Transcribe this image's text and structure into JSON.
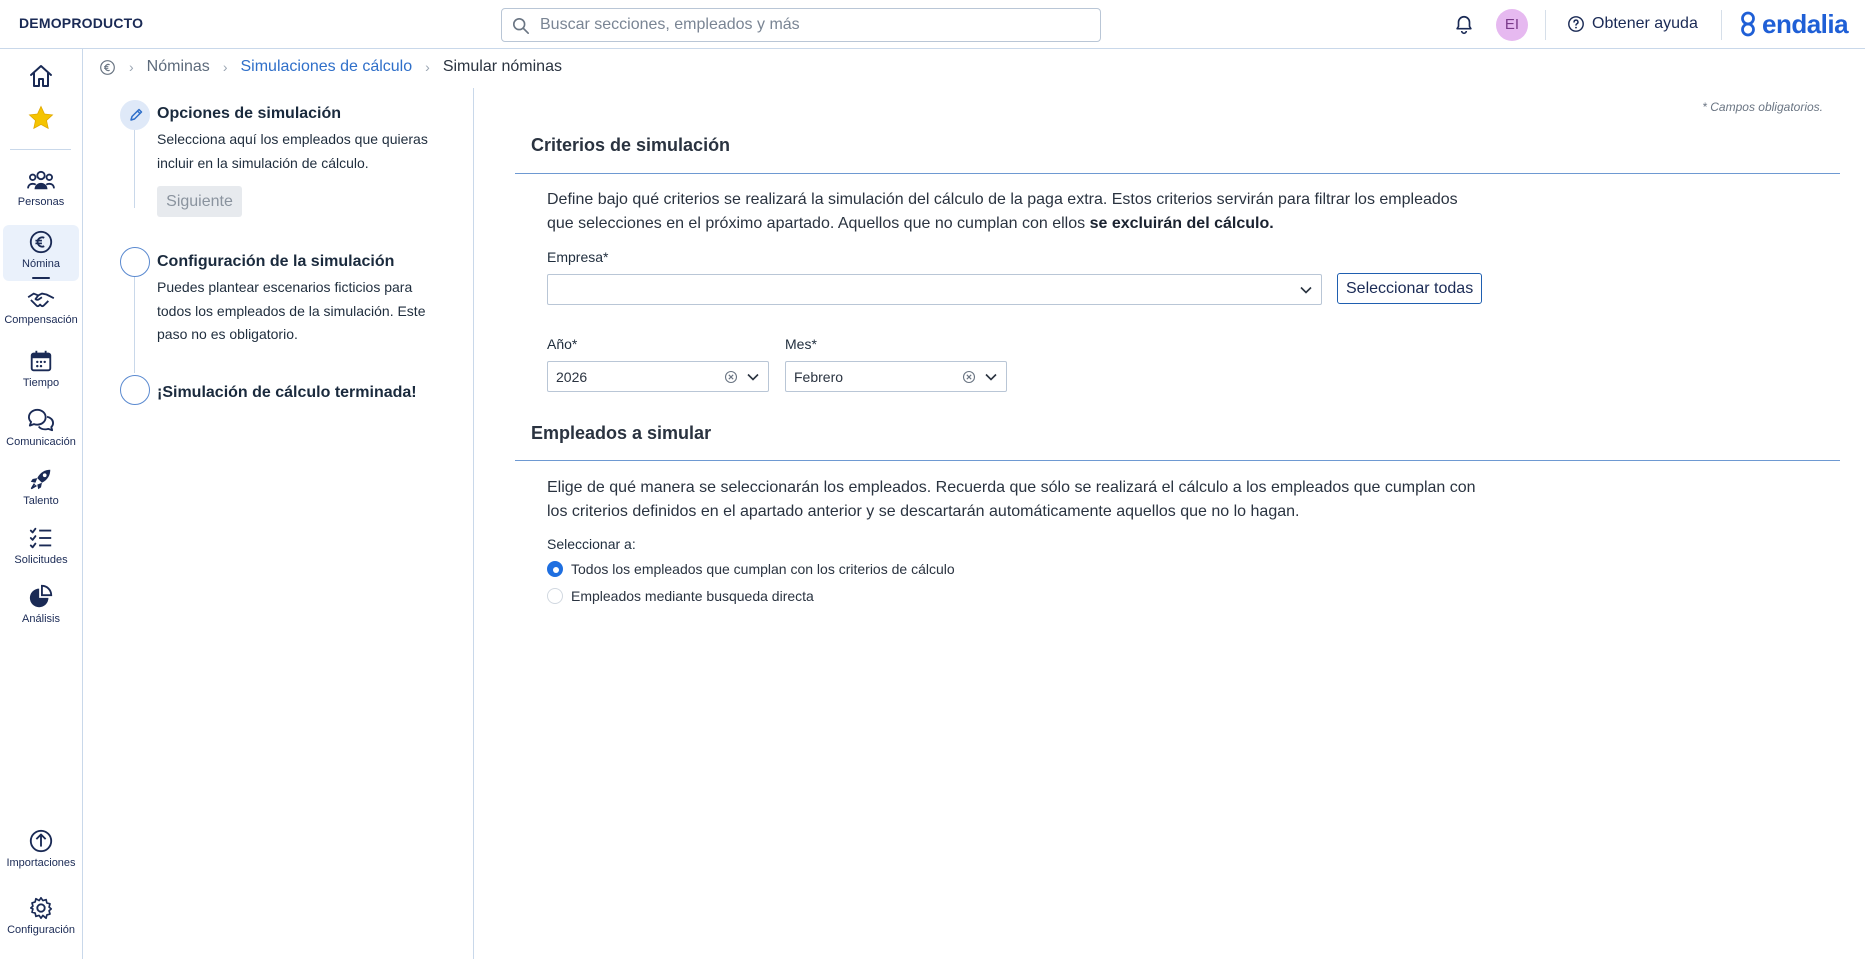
{
  "header": {
    "company": "DEMOPRODUCTO",
    "search_placeholder": "Buscar secciones, empleados y más",
    "avatar_initials": "EI",
    "help_label": "Obtener ayuda",
    "logo_text": "endalia"
  },
  "sidebar": {
    "items": [
      {
        "label": "Personas",
        "icon": "people-icon"
      },
      {
        "label": "Nómina",
        "icon": "euro-icon"
      },
      {
        "label": "Compensación",
        "icon": "handshake-icon"
      },
      {
        "label": "Tiempo",
        "icon": "calendar-icon"
      },
      {
        "label": "Comunicación",
        "icon": "chat-icon"
      },
      {
        "label": "Talento",
        "icon": "rocket-icon"
      },
      {
        "label": "Solicitudes",
        "icon": "checklist-icon"
      },
      {
        "label": "Análisis",
        "icon": "pie-chart-icon"
      },
      {
        "label": "Importaciones",
        "icon": "upload-icon"
      },
      {
        "label": "Configuración",
        "icon": "gear-icon"
      }
    ],
    "active": "Nómina"
  },
  "breadcrumb": {
    "items": [
      "Nóminas",
      "Simulaciones de cálculo",
      "Simular nóminas"
    ]
  },
  "stepper": {
    "steps": [
      {
        "title": "Opciones de simulación",
        "description": "Selecciona aquí los empleados que quieras incluir en la simulación de cálculo."
      },
      {
        "title": "Configuración de la simulación",
        "description": "Puedes plantear escenarios ficticios para todos los empleados de la simulación. Este paso no es obligatorio."
      },
      {
        "title": "¡Simulación de cálculo terminada!",
        "description": ""
      }
    ],
    "next_button": "Siguiente"
  },
  "main": {
    "required_note": "* Campos obligatorios.",
    "criteria": {
      "title": "Criterios de simulación",
      "description": "Define bajo qué criterios se realizará la simulación del cálculo de la paga extra. Estos criterios servirán para filtrar los empleados que selecciones en el próximo apartado. Aquellos que no cumplan con ellos",
      "description_bold": "se excluirán del cálculo.",
      "company_label": "Empresa*",
      "company_value": "",
      "select_all_button": "Seleccionar todas",
      "year_label": "Año*",
      "year_value": "2026",
      "month_label": "Mes*",
      "month_value": "Febrero"
    },
    "employees": {
      "title": "Empleados a simular",
      "description": "Elige de qué manera se seleccionarán los empleados. Recuerda que sólo se realizará el cálculo a los empleados que cumplan con los criterios definidos en el apartado anterior y se descartarán automáticamente aquellos que no lo hagan.",
      "select_label": "Seleccionar a:",
      "options": [
        {
          "label": "Todos los empleados que cumplan con los criterios de cálculo",
          "checked": true
        },
        {
          "label": "Empleados mediante busqueda directa",
          "checked": false
        }
      ]
    }
  },
  "colors": {
    "accent": "#1f5fd6",
    "link": "#2f6fc9",
    "rule": "#6e99d2",
    "avatar_bg": "#e6b9f0"
  }
}
